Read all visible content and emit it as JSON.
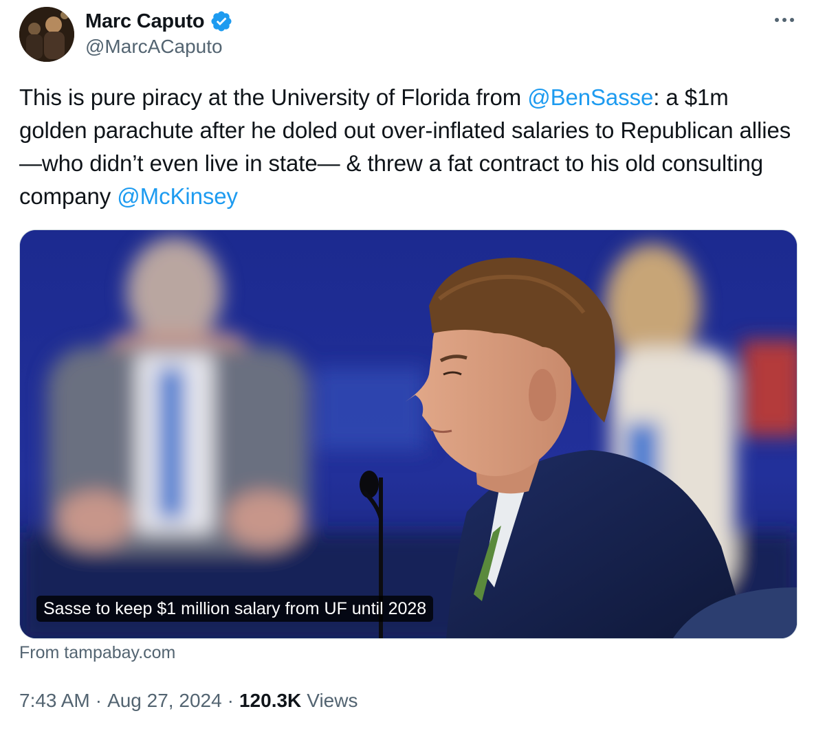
{
  "author": {
    "display_name": "Marc Caputo",
    "handle": "@MarcACaputo",
    "verified": true
  },
  "tweet": {
    "text_parts": [
      {
        "text": "This is pure piracy at the University of Florida from "
      },
      {
        "text": "@BenSasse",
        "mention": true
      },
      {
        "text": ": a $1m golden parachute after he doled out over-inflated salaries to Republican allies —who didn’t even live in state— & threw a fat contract to his old consulting company "
      },
      {
        "text": "@McKinsey",
        "mention": true
      }
    ]
  },
  "media": {
    "caption": "Sasse to keep $1 million salary from UF until 2028",
    "source": "From tampabay.com"
  },
  "meta": {
    "time": "7:43 AM",
    "separator": "·",
    "date": "Aug 27, 2024",
    "views_count": "120.3K",
    "views_label": "Views"
  },
  "colors": {
    "link": "#1d9bf0",
    "secondary_text": "#536471",
    "primary_text": "#0f1419"
  },
  "icons": {
    "verified": "verified-badge-icon",
    "more": "more-options-icon"
  }
}
